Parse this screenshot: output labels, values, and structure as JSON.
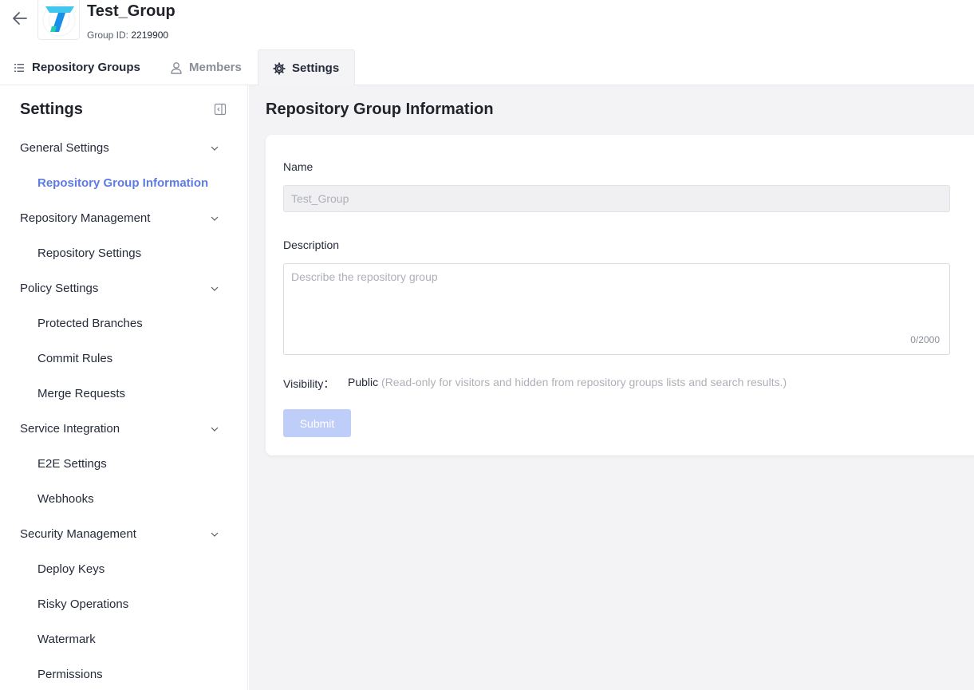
{
  "header": {
    "group_title": "Test_Group",
    "group_id_label": "Group ID:",
    "group_id_value": "2219900",
    "logo_icon": "codearts-logo"
  },
  "tabs": [
    {
      "label": "Repository Groups",
      "icon": "list-icon"
    },
    {
      "label": "Members",
      "icon": "user-icon"
    },
    {
      "label": "Settings",
      "icon": "gear-icon",
      "active": true
    }
  ],
  "sidebar": {
    "title": "Settings",
    "groups": [
      {
        "label": "General Settings",
        "items": [
          {
            "label": "Repository Group Information",
            "active": true
          }
        ]
      },
      {
        "label": "Repository Management",
        "items": [
          {
            "label": "Repository Settings"
          }
        ]
      },
      {
        "label": "Policy Settings",
        "items": [
          {
            "label": "Protected Branches"
          },
          {
            "label": "Commit Rules"
          },
          {
            "label": "Merge Requests"
          }
        ]
      },
      {
        "label": "Service Integration",
        "items": [
          {
            "label": "E2E Settings"
          },
          {
            "label": "Webhooks"
          }
        ]
      },
      {
        "label": "Security Management",
        "items": [
          {
            "label": "Deploy Keys"
          },
          {
            "label": "Risky Operations"
          },
          {
            "label": "Watermark"
          },
          {
            "label": "Permissions"
          }
        ]
      }
    ]
  },
  "main": {
    "title": "Repository Group Information",
    "name_label": "Name",
    "name_value": "Test_Group",
    "description_label": "Description",
    "description_placeholder": "Describe the repository group",
    "description_counter": "0/2000",
    "visibility_label": "Visibility：",
    "visibility_value": "Public",
    "visibility_note": "(Read-only for visitors and hidden from repository groups lists and search results.)",
    "submit_label": "Submit"
  },
  "colors": {
    "accent": "#5e7ce0",
    "submit_disabled": "#bfcdf9",
    "main_bg": "#f3f3f5"
  }
}
